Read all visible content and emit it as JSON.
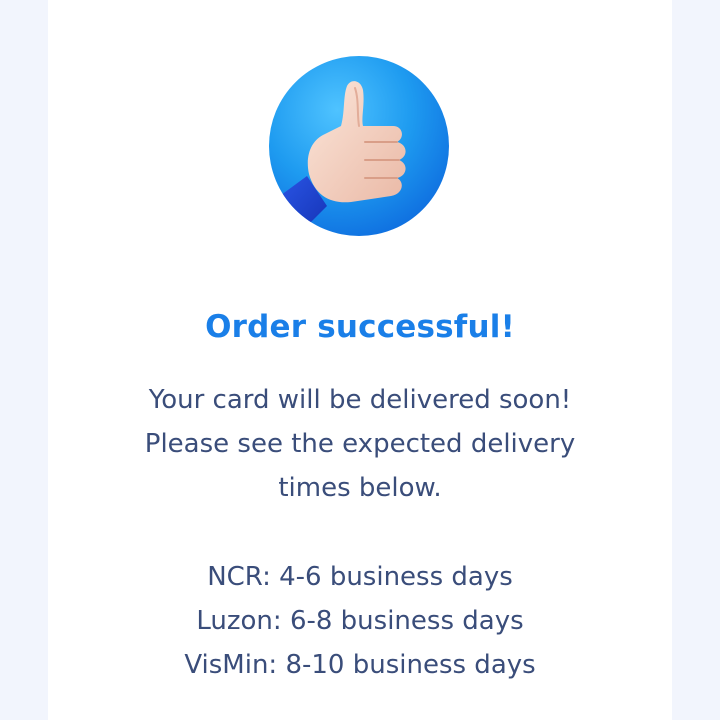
{
  "confirmation": {
    "icon": "thumbs-up-icon",
    "title": "Order successful!",
    "message_lines": [
      "Your card will be delivered soon!",
      "Please see the expected delivery",
      "times below."
    ],
    "delivery_times": [
      "NCR: 4-6 business days",
      "Luzon: 6-8 business days",
      "VisMin: 8-10 business days"
    ]
  },
  "colors": {
    "accent": "#1a7fe8",
    "body_text": "#3a4d7a",
    "page_background": "#f2f5fd",
    "card_background": "#ffffff"
  }
}
